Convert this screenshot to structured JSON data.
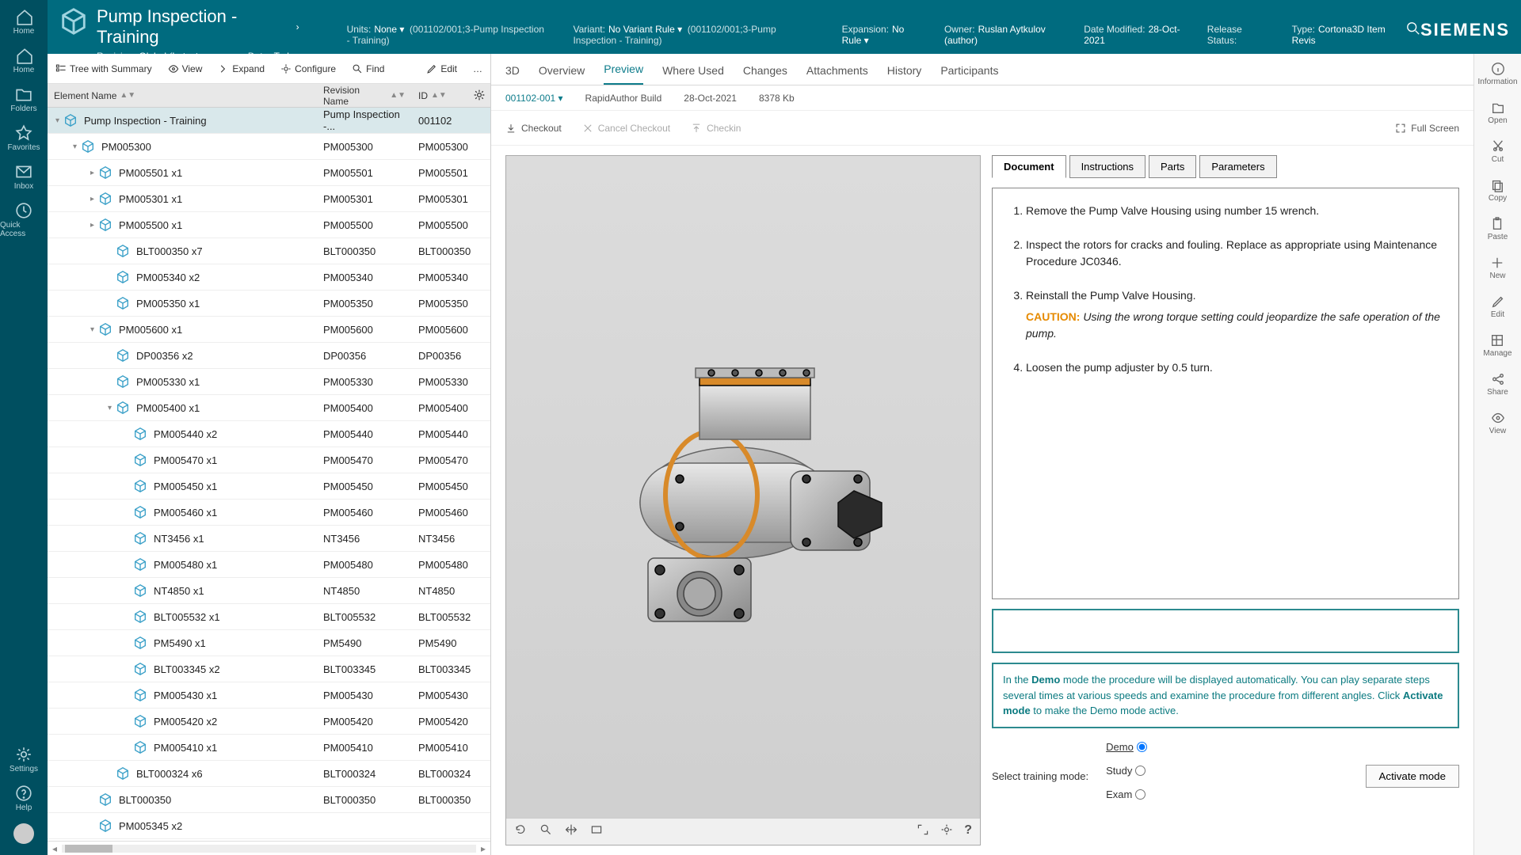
{
  "brand": "SIEMENS",
  "page": {
    "title": "Pump Inspection - Training",
    "revision_label": "Revision:",
    "revision_value": "Global (Latest Working)",
    "date_label": "Date:",
    "date_value": "Today"
  },
  "header_meta": [
    {
      "label": "Units:",
      "value": "None",
      "extra": "(001102/001;3-Pump Inspection - Training)"
    },
    {
      "label": "Variant:",
      "value": "No Variant Rule",
      "extra": "(001102/001;3-Pump Inspection - Training)"
    },
    {
      "label": "Expansion:",
      "value": "No Rule"
    },
    {
      "label": "Owner:",
      "value": "Ruslan Aytkulov (author)"
    },
    {
      "label": "Date Modified:",
      "value": "28-Oct-2021"
    },
    {
      "label": "Release Status:",
      "value": ""
    },
    {
      "label": "Type:",
      "value": "Cortona3D Item Revis"
    }
  ],
  "primary_nav": [
    {
      "icon": "home",
      "label": "Home"
    },
    {
      "icon": "home",
      "label": "Home"
    },
    {
      "icon": "folder",
      "label": "Folders"
    },
    {
      "icon": "star",
      "label": "Favorites"
    },
    {
      "icon": "mail",
      "label": "Inbox"
    },
    {
      "icon": "clock",
      "label": "Quick Access"
    }
  ],
  "primary_nav_bottom": [
    {
      "icon": "gear",
      "label": "Settings"
    },
    {
      "icon": "help",
      "label": "Help"
    }
  ],
  "tree_toolbar": [
    {
      "label": "Tree with Summary",
      "icon": "list"
    },
    {
      "label": "View",
      "icon": "eye"
    },
    {
      "label": "Expand",
      "icon": "expand"
    },
    {
      "label": "Configure",
      "icon": "config"
    },
    {
      "label": "Find",
      "icon": "find"
    },
    {
      "label": "Edit",
      "icon": "edit"
    },
    {
      "label": "…",
      "icon": "more"
    }
  ],
  "tree_headers": {
    "col1": "Element Name",
    "col2": "Revision Name",
    "col3": "ID"
  },
  "tree": [
    {
      "indent": 0,
      "caret": "▾",
      "name": "Pump Inspection - Training",
      "rev": "Pump Inspection -...",
      "id": "001102",
      "selected": true
    },
    {
      "indent": 1,
      "caret": "▾",
      "name": "PM005300",
      "rev": "PM005300",
      "id": "PM005300"
    },
    {
      "indent": 2,
      "caret": "▸",
      "name": "PM005501 x1",
      "rev": "PM005501",
      "id": "PM005501"
    },
    {
      "indent": 2,
      "caret": "▸",
      "name": "PM005301 x1",
      "rev": "PM005301",
      "id": "PM005301"
    },
    {
      "indent": 2,
      "caret": "▸",
      "name": "PM005500 x1",
      "rev": "PM005500",
      "id": "PM005500"
    },
    {
      "indent": 3,
      "caret": "",
      "name": "BLT000350 x7",
      "rev": "BLT000350",
      "id": "BLT000350"
    },
    {
      "indent": 3,
      "caret": "",
      "name": "PM005340 x2",
      "rev": "PM005340",
      "id": "PM005340"
    },
    {
      "indent": 3,
      "caret": "",
      "name": "PM005350 x1",
      "rev": "PM005350",
      "id": "PM005350"
    },
    {
      "indent": 2,
      "caret": "▾",
      "name": "PM005600 x1",
      "rev": "PM005600",
      "id": "PM005600"
    },
    {
      "indent": 3,
      "caret": "",
      "name": "DP00356 x2",
      "rev": "DP00356",
      "id": "DP00356"
    },
    {
      "indent": 3,
      "caret": "",
      "name": "PM005330 x1",
      "rev": "PM005330",
      "id": "PM005330"
    },
    {
      "indent": 3,
      "caret": "▾",
      "name": "PM005400 x1",
      "rev": "PM005400",
      "id": "PM005400"
    },
    {
      "indent": 4,
      "caret": "",
      "name": "PM005440 x2",
      "rev": "PM005440",
      "id": "PM005440"
    },
    {
      "indent": 4,
      "caret": "",
      "name": "PM005470 x1",
      "rev": "PM005470",
      "id": "PM005470"
    },
    {
      "indent": 4,
      "caret": "",
      "name": "PM005450 x1",
      "rev": "PM005450",
      "id": "PM005450"
    },
    {
      "indent": 4,
      "caret": "",
      "name": "PM005460 x1",
      "rev": "PM005460",
      "id": "PM005460"
    },
    {
      "indent": 4,
      "caret": "",
      "name": "NT3456 x1",
      "rev": "NT3456",
      "id": "NT3456"
    },
    {
      "indent": 4,
      "caret": "",
      "name": "PM005480 x1",
      "rev": "PM005480",
      "id": "PM005480"
    },
    {
      "indent": 4,
      "caret": "",
      "name": "NT4850 x1",
      "rev": "NT4850",
      "id": "NT4850"
    },
    {
      "indent": 4,
      "caret": "",
      "name": "BLT005532 x1",
      "rev": "BLT005532",
      "id": "BLT005532"
    },
    {
      "indent": 4,
      "caret": "",
      "name": "PM5490 x1",
      "rev": "PM5490",
      "id": "PM5490"
    },
    {
      "indent": 4,
      "caret": "",
      "name": "BLT003345 x2",
      "rev": "BLT003345",
      "id": "BLT003345"
    },
    {
      "indent": 4,
      "caret": "",
      "name": "PM005430 x1",
      "rev": "PM005430",
      "id": "PM005430"
    },
    {
      "indent": 4,
      "caret": "",
      "name": "PM005420 x2",
      "rev": "PM005420",
      "id": "PM005420"
    },
    {
      "indent": 4,
      "caret": "",
      "name": "PM005410 x1",
      "rev": "PM005410",
      "id": "PM005410"
    },
    {
      "indent": 3,
      "caret": "",
      "name": "BLT000324 x6",
      "rev": "BLT000324",
      "id": "BLT000324"
    },
    {
      "indent": 2,
      "caret": "",
      "name": "BLT000350",
      "rev": "BLT000350",
      "id": "BLT000350"
    },
    {
      "indent": 2,
      "caret": "",
      "name": "PM005345 x2",
      "rev": "",
      "id": ""
    }
  ],
  "tabs": [
    "3D",
    "Overview",
    "Preview",
    "Where Used",
    "Changes",
    "Attachments",
    "History",
    "Participants"
  ],
  "active_tab": "Preview",
  "info_row": {
    "rev": "001102-001",
    "build": "RapidAuthor Build",
    "date": "28-Oct-2021",
    "size": "8378 Kb"
  },
  "actions": {
    "checkout": "Checkout",
    "cancel": "Cancel Checkout",
    "checkin": "Checkin",
    "full": "Full Screen"
  },
  "doc_tabs": [
    "Document",
    "Instructions",
    "Parts",
    "Parameters"
  ],
  "doc_active": "Document",
  "steps": [
    {
      "text": "Remove the Pump Valve Housing using number 15 wrench."
    },
    {
      "text": "Inspect the rotors for cracks and fouling. Replace as appropriate using Maintenance Procedure JC0346."
    },
    {
      "text": "Reinstall the Pump Valve Housing.",
      "caution": "Using the wrong torque setting could jeopardize the safe operation of the pump."
    },
    {
      "text": "Loosen the pump adjuster by 0.5 turn."
    }
  ],
  "caution_label": "CAUTION:",
  "demo_text": {
    "p1a": "In the ",
    "p1b": "Demo",
    "p1c": " mode the procedure will be displayed automatically. You can play separate steps several times at various speeds and examine the procedure from different angles. Click ",
    "p1d": "Activate mode",
    "p1e": " to make the Demo mode active."
  },
  "mode_row": {
    "label": "Select training mode:",
    "opts": [
      "Demo",
      "Study",
      "Exam"
    ],
    "selected": "Demo",
    "button": "Activate mode"
  },
  "right_rail": [
    "Information",
    "Open",
    "Cut",
    "Copy",
    "Paste",
    "New",
    "Edit",
    "Manage",
    "Share",
    "View"
  ]
}
